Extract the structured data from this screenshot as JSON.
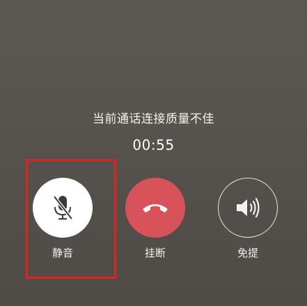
{
  "call": {
    "quality_status": "当前通话连接质量不佳",
    "duration": "00:55"
  },
  "controls": {
    "mute": {
      "label": "静音",
      "icon": "mic-off-icon"
    },
    "hangup": {
      "label": "挂断",
      "icon": "phone-hangup-icon"
    },
    "speaker": {
      "label": "免提",
      "icon": "speaker-icon"
    }
  },
  "colors": {
    "background": "#56524d",
    "mute_button": "#ffffff",
    "hangup_button": "#d8525a",
    "highlight": "#e2221f"
  }
}
